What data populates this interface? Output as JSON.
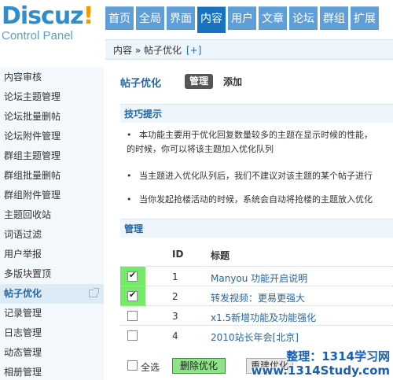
{
  "logo": {
    "brand_main": "Discuz",
    "brand_bang": "!",
    "subtitle": "Control Panel"
  },
  "topnav": [
    "首页",
    "全局",
    "界面",
    "内容",
    "用户",
    "文章",
    "论坛",
    "群组",
    "扩展"
  ],
  "topnav_active": "内容",
  "breadcrumb": {
    "path": "内容 » 帖子优化",
    "plus": "[+]"
  },
  "sidebar": {
    "items": [
      "内容审核",
      "论坛主题管理",
      "论坛批量删帖",
      "论坛附件管理",
      "群组主题管理",
      "群组批量删帖",
      "群组附件管理",
      "主题回收站",
      "词语过滤",
      "用户举报",
      "多版块置顶",
      "帖子优化",
      "记录管理",
      "日志管理",
      "动态管理",
      "相册管理"
    ],
    "active": "帖子优化"
  },
  "main": {
    "title": "帖子优化",
    "manage_label": "管理",
    "add_label": "添加",
    "tips_title": "技巧提示",
    "tips": [
      "本功能主要用于优化回复数量较多的主题在显示时候的性能，",
      "的时候，你可以将该主题加入优化队列",
      "当主题进入优化队列后，我们不建议对该主题的某个帖子进行",
      "当你发起抢楼活动的时候，系统会自动将抢楼的主题放入优化"
    ],
    "manage_title": "管理",
    "table": {
      "col_id": "ID",
      "col_title": "标题",
      "rows": [
        {
          "id": "1",
          "title": "Manyou 功能开启说明",
          "checked": true
        },
        {
          "id": "2",
          "title": "转发视频：更易更强大",
          "checked": true
        },
        {
          "id": "3",
          "title": "x1.5新增功能及功能强化",
          "checked": false
        },
        {
          "id": "4",
          "title": "2010站长年会[北京]",
          "checked": false
        }
      ]
    },
    "select_all_label": "全选",
    "delete_label": "删除优化",
    "reset_label": "重建优化"
  },
  "watermark": {
    "line1": "整理：1314学习网",
    "line2": "www.1314Study.com"
  },
  "colors": {
    "nav_active": "#1773bf",
    "nav": "#5f9ed6",
    "highlight": "#77e96a",
    "link": "#2366a8"
  }
}
